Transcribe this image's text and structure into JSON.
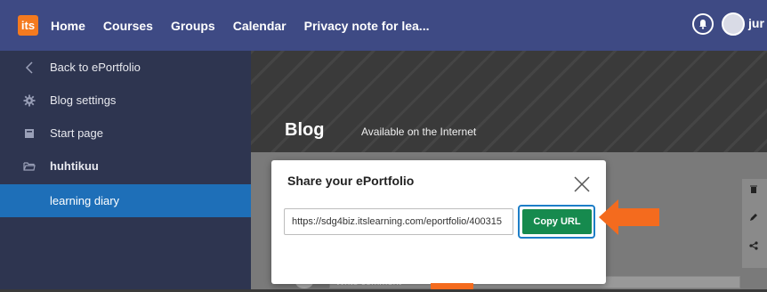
{
  "topbar": {
    "logo_text": "its",
    "nav": [
      "Home",
      "Courses",
      "Groups",
      "Calendar",
      "Privacy note for lea..."
    ],
    "user_name": "jur"
  },
  "sidebar": {
    "items": [
      {
        "label": "Back to ePortfolio",
        "icon": "chevron-left-icon"
      },
      {
        "label": "Blog settings",
        "icon": "gear-icon"
      },
      {
        "label": "Start page",
        "icon": "book-icon"
      },
      {
        "label": "huhtikuu",
        "icon": "folder-open-icon"
      },
      {
        "label": "learning diary",
        "icon": ""
      }
    ]
  },
  "banner": {
    "title": "Blog",
    "subtitle": "Available on the Internet"
  },
  "modal": {
    "title": "Share your ePortfolio",
    "url": "https://sdg4biz.itslearning.com/eportfolio/400315",
    "copy_label": "Copy URL"
  },
  "comment": {
    "placeholder": "Write comment"
  },
  "colors": {
    "topbar": "#3e4a84",
    "sidebar": "#2e3550",
    "active": "#1e6fb8",
    "copy_button": "#168a4e",
    "arrow": "#f46b1e"
  }
}
